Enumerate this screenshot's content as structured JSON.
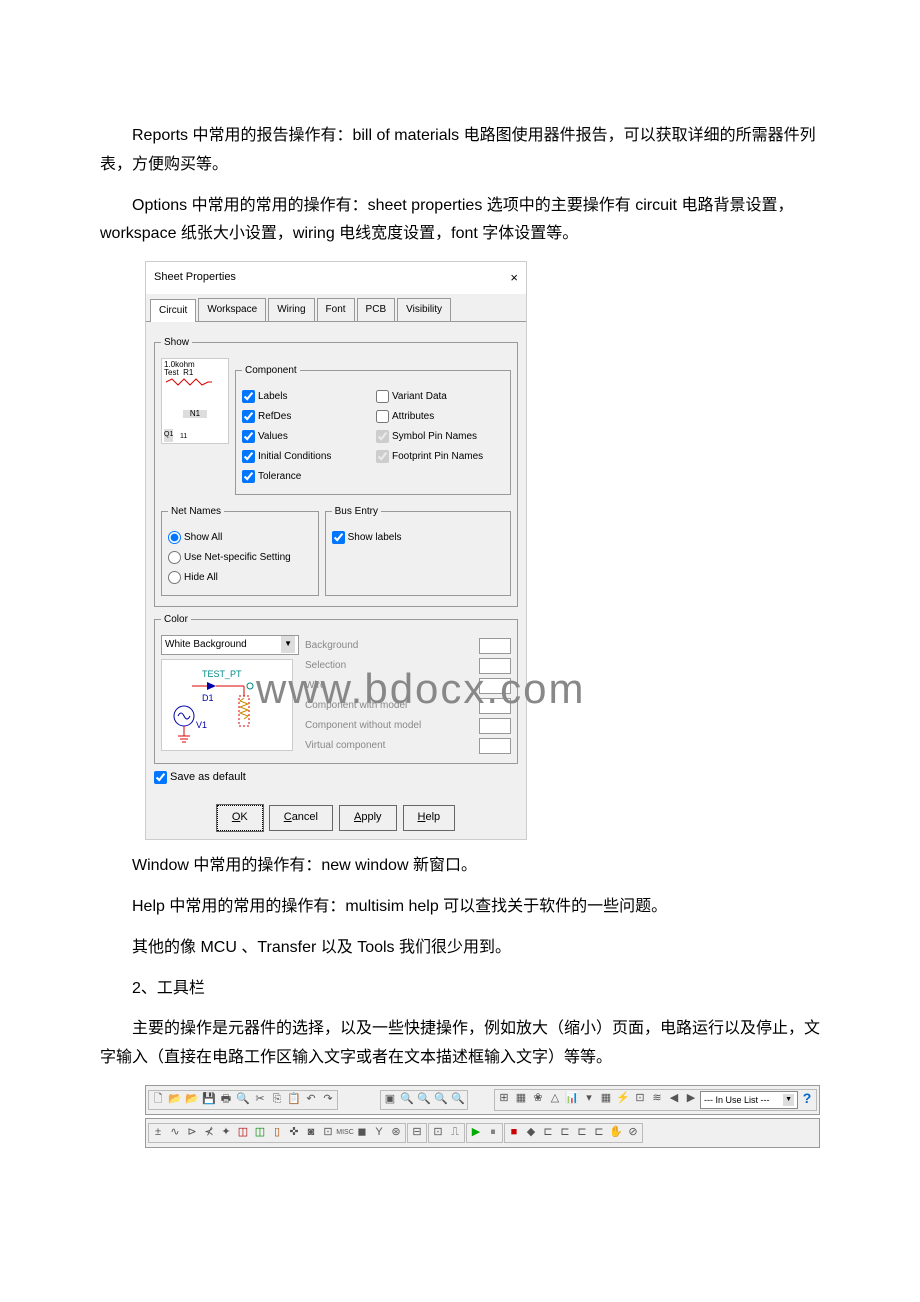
{
  "p1": "Reports 中常用的报告操作有：bill of materials 电路图使用器件报告，可以获取详细的所需器件列表，方便购买等。",
  "p2": "Options 中常用的常用的操作有：sheet properties 选项中的主要操作有 circuit 电路背景设置，workspace 纸张大小设置，wiring 电线宽度设置，font 字体设置等。",
  "dlg": {
    "title": "Sheet Properties",
    "close": "×",
    "tabs": [
      "Circuit",
      "Workspace",
      "Wiring",
      "Font",
      "PCB",
      "Visibility"
    ],
    "show": "Show",
    "component": "Component",
    "pv": {
      "a": "1.0kohm",
      "b": "Test",
      "c": "R1",
      "d": "N1",
      "e": "Q1",
      "f": "11"
    },
    "cbs": {
      "labels": "Labels",
      "refdes": "RefDes",
      "values": "Values",
      "init": "Initial Conditions",
      "tol": "Tolerance",
      "vd": "Variant Data",
      "attr": "Attributes",
      "spn": "Symbol Pin Names",
      "fpn": "Footprint Pin Names"
    },
    "netNames": "Net Names",
    "showAll": "Show All",
    "useNet": "Use Net-specific Setting",
    "hideAll": "Hide All",
    "busEntry": "Bus Entry",
    "showLabels": "Show labels",
    "color": "Color",
    "whiteBg": "White Background",
    "pv2": {
      "tp": "TEST_PT",
      "d1": "D1",
      "v1": "V1"
    },
    "cl": {
      "bg": "Background",
      "sel": "Selection",
      "wire": "Wire",
      "cwm": "Component with model",
      "cwom": "Component without model",
      "vc": "Virtual component"
    },
    "saveDef": "Save as default",
    "btns": {
      "ok": "OK",
      "cancel": "Cancel",
      "apply": "Apply",
      "help": "Help"
    }
  },
  "wm": "www.bdocx.com",
  "p3": "Window 中常用的操作有：new window 新窗口。",
  "p4": "Help 中常用的常用的操作有：multisim help 可以查找关于软件的一些问题。",
  "p5": "其他的像 MCU 、Transfer 以及 Tools 我们很少用到。",
  "p6": "2、工具栏",
  "p7": "主要的操作是元器件的选择，以及一些快捷操作，例如放大（缩小）页面，电路运行以及停止，文字输入（直接在电路工作区输入文字或者在文本描述框输入文字）等等。",
  "tb": {
    "inuse": "--- In Use List ---",
    "q": "?"
  }
}
